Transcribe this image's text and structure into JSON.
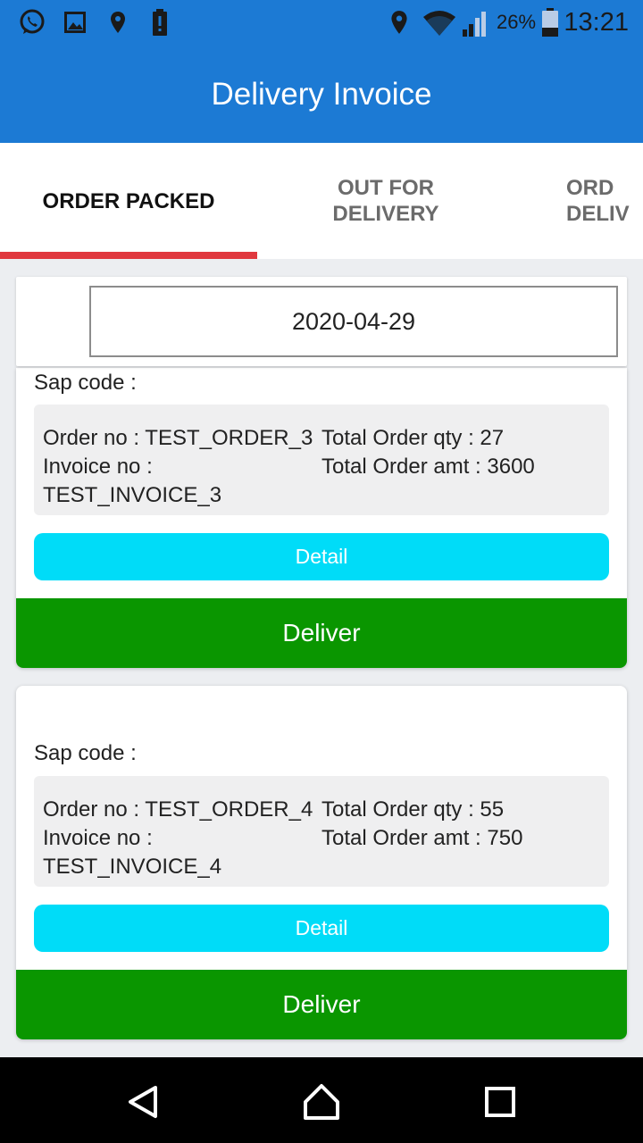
{
  "status_bar": {
    "battery_percent": "26%",
    "time": "13:21",
    "icons": [
      "whatsapp-icon",
      "image-icon",
      "location-icon",
      "battery-alert-icon",
      "location-icon",
      "wifi-icon",
      "signal-icon",
      "battery-icon"
    ]
  },
  "app_bar": {
    "title": "Delivery Invoice"
  },
  "tabs": [
    {
      "line1": "ORDER PACKED",
      "line2": "",
      "selected": true
    },
    {
      "line1": "OUT FOR",
      "line2": "DELIVERY",
      "selected": false
    },
    {
      "line1": "ORD",
      "line2": "DELIV",
      "selected": false
    }
  ],
  "date_filter": {
    "value": "2020-04-29"
  },
  "orders": [
    {
      "sap_label": "Sap code :",
      "order_no": "Order no : TEST_ORDER_3",
      "invoice_label": "Invoice no :",
      "invoice_no": "TEST_INVOICE_3",
      "total_qty": "Total Order qty : 27",
      "total_amt": "Total Order amt : 3600",
      "detail_label": "Detail",
      "deliver_label": "Deliver"
    },
    {
      "sap_label": "Sap code :",
      "order_no": "Order no : TEST_ORDER_4",
      "invoice_label": "Invoice no :",
      "invoice_no": "TEST_INVOICE_4",
      "total_qty": "Total Order qty : 55",
      "total_amt": "Total Order amt : 750",
      "detail_label": "Detail",
      "deliver_label": "Deliver"
    }
  ],
  "colors": {
    "app_bar": "#1c7ad4",
    "tab_indicator": "#e0383e",
    "detail_button": "#00dcf8",
    "deliver_button": "#0a9600"
  },
  "nav_bar": {
    "icons": [
      "back-icon",
      "home-icon",
      "recents-icon"
    ]
  }
}
